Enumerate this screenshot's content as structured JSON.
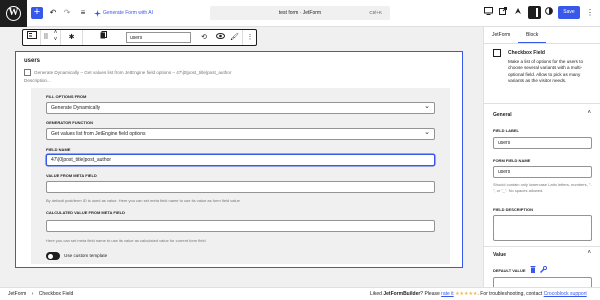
{
  "topbar": {
    "add_symbol": "+",
    "undo_symbol": "↶",
    "redo_symbol": "↷",
    "list_view_symbol": "≡",
    "generate_ai_label": "Generate Form with AI",
    "document_title": "test form · JetForm",
    "shortcut": "Ctrl+K",
    "save_label": "Save",
    "kebab_symbol": "⋮",
    "accent_color": "#3858e9"
  },
  "block_toolbar": {
    "search_value": "users",
    "more_symbol": "⋮"
  },
  "block": {
    "label": "users",
    "generate_dynamically_label": "Generate Dynamically – Get values list from JetEngine field options – 47\\|0|post_title|post_author",
    "description_placeholder": "Description...",
    "fill_options_label": "FILL OPTIONS FROM",
    "fill_options_value": "Generate Dynamically",
    "generator_label": "GENERATOR FUNCTION",
    "generator_value": "Get values list from JetEngine field options",
    "field_name_label": "FIELD NAME",
    "field_name_value": "47\\|0|post_title|post_author",
    "value_from_meta_label": "VALUE FROM META FIELD",
    "value_from_meta_help": "By default post/term ID is used as value. Here you can set meta field name to use its value as form field value",
    "calculated_label": "CALCULATED VALUE FROM META FIELD",
    "calculated_help": "Here you can set meta field name to use its value as calculated value for current form field",
    "custom_template_label": "Use custom template"
  },
  "sidebar": {
    "tabs": [
      {
        "label": "JetForm"
      },
      {
        "label": "Block"
      }
    ],
    "block_name": "Checkbox Field",
    "block_description": "Make a list of options for the users to choose several variants with a multi-optional field. Allow to pick as many variants as the visitor needs.",
    "general_heading": "General",
    "field_label_label": "FIELD LABEL",
    "field_label_value": "users",
    "form_field_name_label": "FORM FIELD NAME",
    "form_field_name_value": "users",
    "form_field_name_help": "Should contain only lowercase Latin letters, numbers, \"-\", or \"_\". No spaces allowed.",
    "field_description_label": "FIELD DESCRIPTION",
    "value_heading": "Value",
    "default_value_label": "DEFAULT VALUE"
  },
  "footer": {
    "breadcrumb_root": "JetForm",
    "breadcrumb_separator": "›",
    "breadcrumb_current": "Checkbox Field",
    "rate_prefix": "Liked ",
    "rate_brand": "JetFormBuilder",
    "rate_mid": "? Please ",
    "rate_link": "rate it",
    "stars": "★★★★★",
    "rate_suffix": ". For troubleshooting, contact ",
    "support_link": "Crocoblock support"
  }
}
